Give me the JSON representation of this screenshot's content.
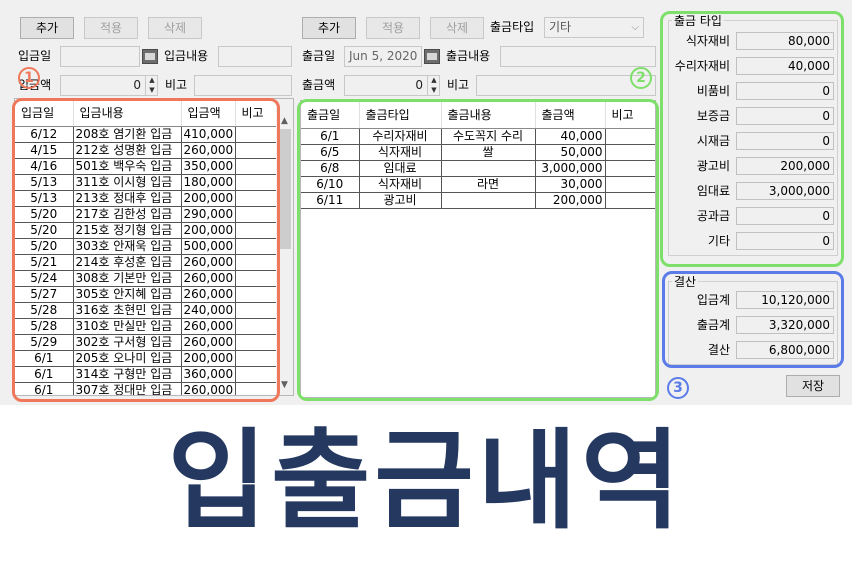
{
  "left_form": {
    "add_label": "추가",
    "apply_label": "적용",
    "delete_label": "삭제",
    "date_label": "입금일",
    "content_label": "입금내용",
    "amount_label": "입금액",
    "amount_value": "0",
    "note_label": "비고"
  },
  "left_table": {
    "headers": [
      "입금일",
      "입금내용",
      "입금액",
      "비고"
    ],
    "rows": [
      [
        "6/12",
        "208호 염기환 입금",
        "410,000",
        ""
      ],
      [
        "4/15",
        "212호 성명환 입금",
        "260,000",
        ""
      ],
      [
        "4/16",
        "501호 백우숙 입금",
        "350,000",
        ""
      ],
      [
        "5/13",
        "311호 이시형 입금",
        "180,000",
        ""
      ],
      [
        "5/13",
        "213호 정대후 입금",
        "200,000",
        ""
      ],
      [
        "5/20",
        "217호 김한성 입금",
        "290,000",
        ""
      ],
      [
        "5/20",
        "215호 정기형 입금",
        "200,000",
        ""
      ],
      [
        "5/20",
        "303호 안재욱 입금",
        "500,000",
        ""
      ],
      [
        "5/21",
        "214호 후성훈 입금",
        "260,000",
        ""
      ],
      [
        "5/24",
        "308호 기본만 입금",
        "260,000",
        ""
      ],
      [
        "5/27",
        "305호 안지혜 입금",
        "260,000",
        ""
      ],
      [
        "5/28",
        "316호 초현민 입금",
        "240,000",
        ""
      ],
      [
        "5/28",
        "310호 만실만 입금",
        "260,000",
        ""
      ],
      [
        "5/29",
        "302호 구서형 입금",
        "260,000",
        ""
      ],
      [
        "6/1",
        "205호 오나미 입금",
        "200,000",
        ""
      ],
      [
        "6/1",
        "314호 구형만 입금",
        "360,000",
        ""
      ],
      [
        "6/1",
        "307호 정대만 입금",
        "260,000",
        ""
      ]
    ]
  },
  "mid_form": {
    "add_label": "추가",
    "apply_label": "적용",
    "delete_label": "삭제",
    "type_label": "출금타입",
    "type_value": "기타",
    "date_label": "출금일",
    "date_value": "Jun  5, 2020",
    "content_label": "출금내용",
    "amount_label": "출금액",
    "amount_value": "0",
    "note_label": "비고"
  },
  "mid_table": {
    "headers": [
      "출금일",
      "출금타입",
      "출금내용",
      "출금액",
      "비고"
    ],
    "rows": [
      [
        "6/1",
        "수리자재비",
        "수도꼭지 수리",
        "40,000",
        ""
      ],
      [
        "6/5",
        "식자재비",
        "쌀",
        "50,000",
        ""
      ],
      [
        "6/8",
        "임대료",
        "",
        "3,000,000",
        ""
      ],
      [
        "6/10",
        "식자재비",
        "라면",
        "30,000",
        ""
      ],
      [
        "6/11",
        "광고비",
        "",
        "200,000",
        ""
      ]
    ]
  },
  "type_panel": {
    "title": "출금 타입",
    "items": [
      {
        "label": "식자재비",
        "value": "80,000"
      },
      {
        "label": "수리자재비",
        "value": "40,000"
      },
      {
        "label": "비품비",
        "value": "0"
      },
      {
        "label": "보증금",
        "value": "0"
      },
      {
        "label": "시재금",
        "value": "0"
      },
      {
        "label": "광고비",
        "value": "200,000"
      },
      {
        "label": "임대료",
        "value": "3,000,000"
      },
      {
        "label": "공과금",
        "value": "0"
      },
      {
        "label": "기타",
        "value": "0"
      }
    ]
  },
  "settle_panel": {
    "title": "결산",
    "items": [
      {
        "label": "입금계",
        "value": "10,120,000"
      },
      {
        "label": "출금계",
        "value": "3,320,000"
      },
      {
        "label": "결산",
        "value": "6,800,000"
      }
    ]
  },
  "save_label": "저장",
  "badges": [
    "1",
    "2",
    "3"
  ],
  "headline": "입출금내역",
  "colors": {
    "orange": "#f0785a",
    "green": "#7ee06a",
    "blue": "#5b7be8",
    "headline": "#243860"
  }
}
